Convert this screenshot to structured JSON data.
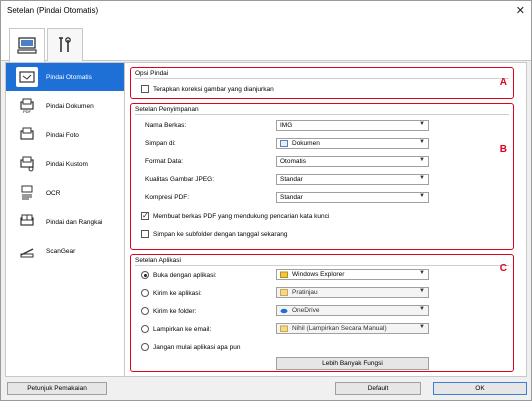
{
  "window": {
    "title": "Setelan (Pindai Otomatis)",
    "close": "✕"
  },
  "tabs": [
    {
      "icon": "computer-icon"
    },
    {
      "icon": "tools-icon"
    }
  ],
  "sidebar": {
    "items": [
      {
        "label": "Pindai Otomatis",
        "selected": true
      },
      {
        "label": "Pindai Dokumen"
      },
      {
        "label": "Pindai Foto"
      },
      {
        "label": "Pindai Kustom"
      },
      {
        "label": "OCR"
      },
      {
        "label": "Pindai dan Rangkai"
      },
      {
        "label": "ScanGear"
      }
    ]
  },
  "opsi": {
    "title": "Opsi Pindai",
    "badge": "A",
    "checkbox": "Terapkan koreksi gambar yang dianjurkan"
  },
  "penyimpanan": {
    "title": "Setelan Penyimpanan",
    "badge": "B",
    "fields": [
      {
        "label": "Nama Berkas:",
        "value": "IMG"
      },
      {
        "label": "Simpan di:",
        "value": "Dokumen"
      },
      {
        "label": "Format Data:",
        "value": "Otomatis"
      },
      {
        "label": "Kualitas Gambar JPEG:",
        "value": "Standar"
      },
      {
        "label": "Kompresi PDF:",
        "value": "Standar"
      }
    ],
    "check1": "Membuat berkas PDF yang mendukung pencarian kata kunci",
    "check2": "Simpan ke subfolder dengan tanggal sekarang"
  },
  "aplikasi": {
    "title": "Setelan Aplikasi",
    "badge": "C",
    "options": [
      {
        "label": "Buka dengan aplikasi:",
        "value": "Windows Explorer"
      },
      {
        "label": "Kirim ke aplikasi:",
        "value": "Pratinjau"
      },
      {
        "label": "Kirim ke folder:",
        "value": "OneDrive"
      },
      {
        "label": "Lampirkan ke email:",
        "value": "Nihil (Lampirkan Secara Manual)"
      },
      {
        "label": "Jangan mulai aplikasi apa pun"
      }
    ],
    "more_button": "Lebih Banyak Fungsi"
  },
  "footer": {
    "help": "Petunjuk Pemakaian",
    "defaults": "Default",
    "ok": "OK"
  },
  "colors": {
    "accent": "#e2001a",
    "selection": "#1e6fd6"
  }
}
